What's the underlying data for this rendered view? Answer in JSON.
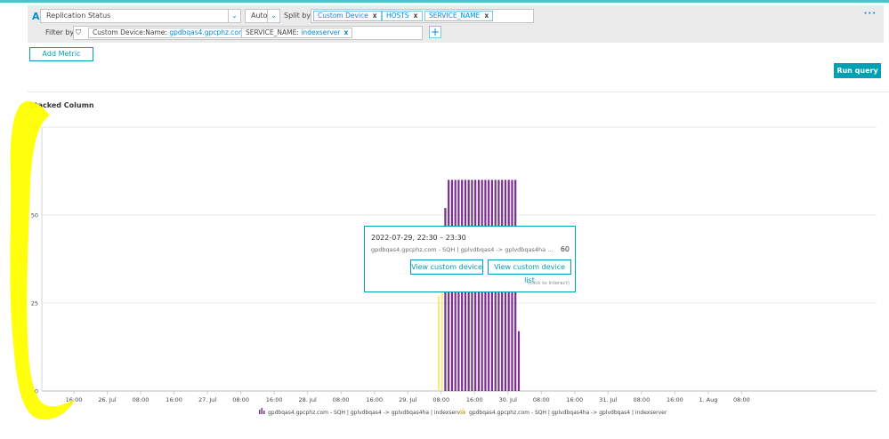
{
  "query": {
    "letter": "A",
    "metric": "Replication Status",
    "aggregation": "Auto",
    "split_by_label": "Split by",
    "split_tags": [
      "Custom Device",
      "HOSTS",
      "SERVICE_NAME"
    ],
    "filter_by_label": "Filter by",
    "filters": [
      {
        "key": "Custom Device:Name: ",
        "value": "gpdbqas4.gpcphz.com -"
      },
      {
        "key": "SERVICE_NAME: ",
        "value": "indexserver"
      }
    ],
    "remove_glyph": "x",
    "add_filter_glyph": "+",
    "more_glyph": "···",
    "dropdown_glyph": "⌄",
    "filter_glyph": "⛉"
  },
  "add_metric_label": "Add Metric",
  "run_query_label": "Run query",
  "chart_title": "Stacked Column",
  "tooltip": {
    "time": "2022-07-29, 22:30 – 23:30",
    "series": "gpdbqas4.gpcphz.com - SQH | gplvdbqas4 -> gplvdbqas4ha | indexserver",
    "value": "60",
    "view_device": "View custom device",
    "view_device_list": "View custom device list",
    "hint": "(click to interact)"
  },
  "colors": {
    "accent": "#00a1b2",
    "series_purple": "#7b2f8e",
    "series_yellow": "#f7e98a",
    "highlight": "#ffff00"
  },
  "chart_data": {
    "type": "bar",
    "stacked": true,
    "title": "Stacked Column",
    "ylim": [
      0,
      75
    ],
    "yticks": [
      0,
      25,
      50,
      75
    ],
    "x_tick_labels": [
      "16:00",
      "26. Jul",
      "08:00",
      "16:00",
      "27. Jul",
      "08:00",
      "16:00",
      "28. Jul",
      "08:00",
      "16:00",
      "29. Jul",
      "08:00",
      "16:00",
      "30. Jul",
      "08:00",
      "16:00",
      "31. Jul",
      "08:00",
      "16:00",
      "1. Aug",
      "08:00"
    ],
    "x_range_hours": [
      -8,
      192
    ],
    "x_tick_hours": [
      -8,
      0,
      8,
      16,
      24,
      32,
      40,
      48,
      56,
      64,
      72,
      80,
      88,
      96,
      104,
      112,
      120,
      128,
      136,
      144,
      152
    ],
    "series": [
      {
        "name": "gpdbqas4.gpcphz.com - SQH | gplvdbqas4 -> gplvdbqas4ha | indexserver",
        "color": "#7b2f8e",
        "points": [
          {
            "hour": 80.2,
            "value": 0
          },
          {
            "hour": 81.0,
            "value": 52
          },
          {
            "hour": 81.8,
            "value": 60
          },
          {
            "hour": 82.6,
            "value": 60
          },
          {
            "hour": 83.4,
            "value": 60
          },
          {
            "hour": 84.2,
            "value": 60
          },
          {
            "hour": 85.0,
            "value": 60
          },
          {
            "hour": 85.8,
            "value": 60
          },
          {
            "hour": 86.6,
            "value": 60
          },
          {
            "hour": 87.4,
            "value": 60
          },
          {
            "hour": 88.2,
            "value": 60
          },
          {
            "hour": 89.0,
            "value": 60
          },
          {
            "hour": 89.8,
            "value": 60
          },
          {
            "hour": 90.6,
            "value": 60
          },
          {
            "hour": 91.4,
            "value": 60
          },
          {
            "hour": 92.2,
            "value": 60
          },
          {
            "hour": 93.0,
            "value": 60
          },
          {
            "hour": 93.8,
            "value": 60
          },
          {
            "hour": 94.6,
            "value": 60
          },
          {
            "hour": 95.4,
            "value": 60
          },
          {
            "hour": 96.2,
            "value": 60
          },
          {
            "hour": 97.0,
            "value": 60
          },
          {
            "hour": 97.8,
            "value": 60
          },
          {
            "hour": 98.6,
            "value": 17
          }
        ]
      },
      {
        "name": "gpdbqas4.gpcphz.com - SQH | gplvdbqas4ha -> gplvdbqas4 | indexserver",
        "color": "#f7e98a",
        "points": [
          {
            "hour": 79.4,
            "value": 27
          },
          {
            "hour": 80.2,
            "value": 32
          }
        ]
      }
    ],
    "legend_position": "bottom"
  }
}
